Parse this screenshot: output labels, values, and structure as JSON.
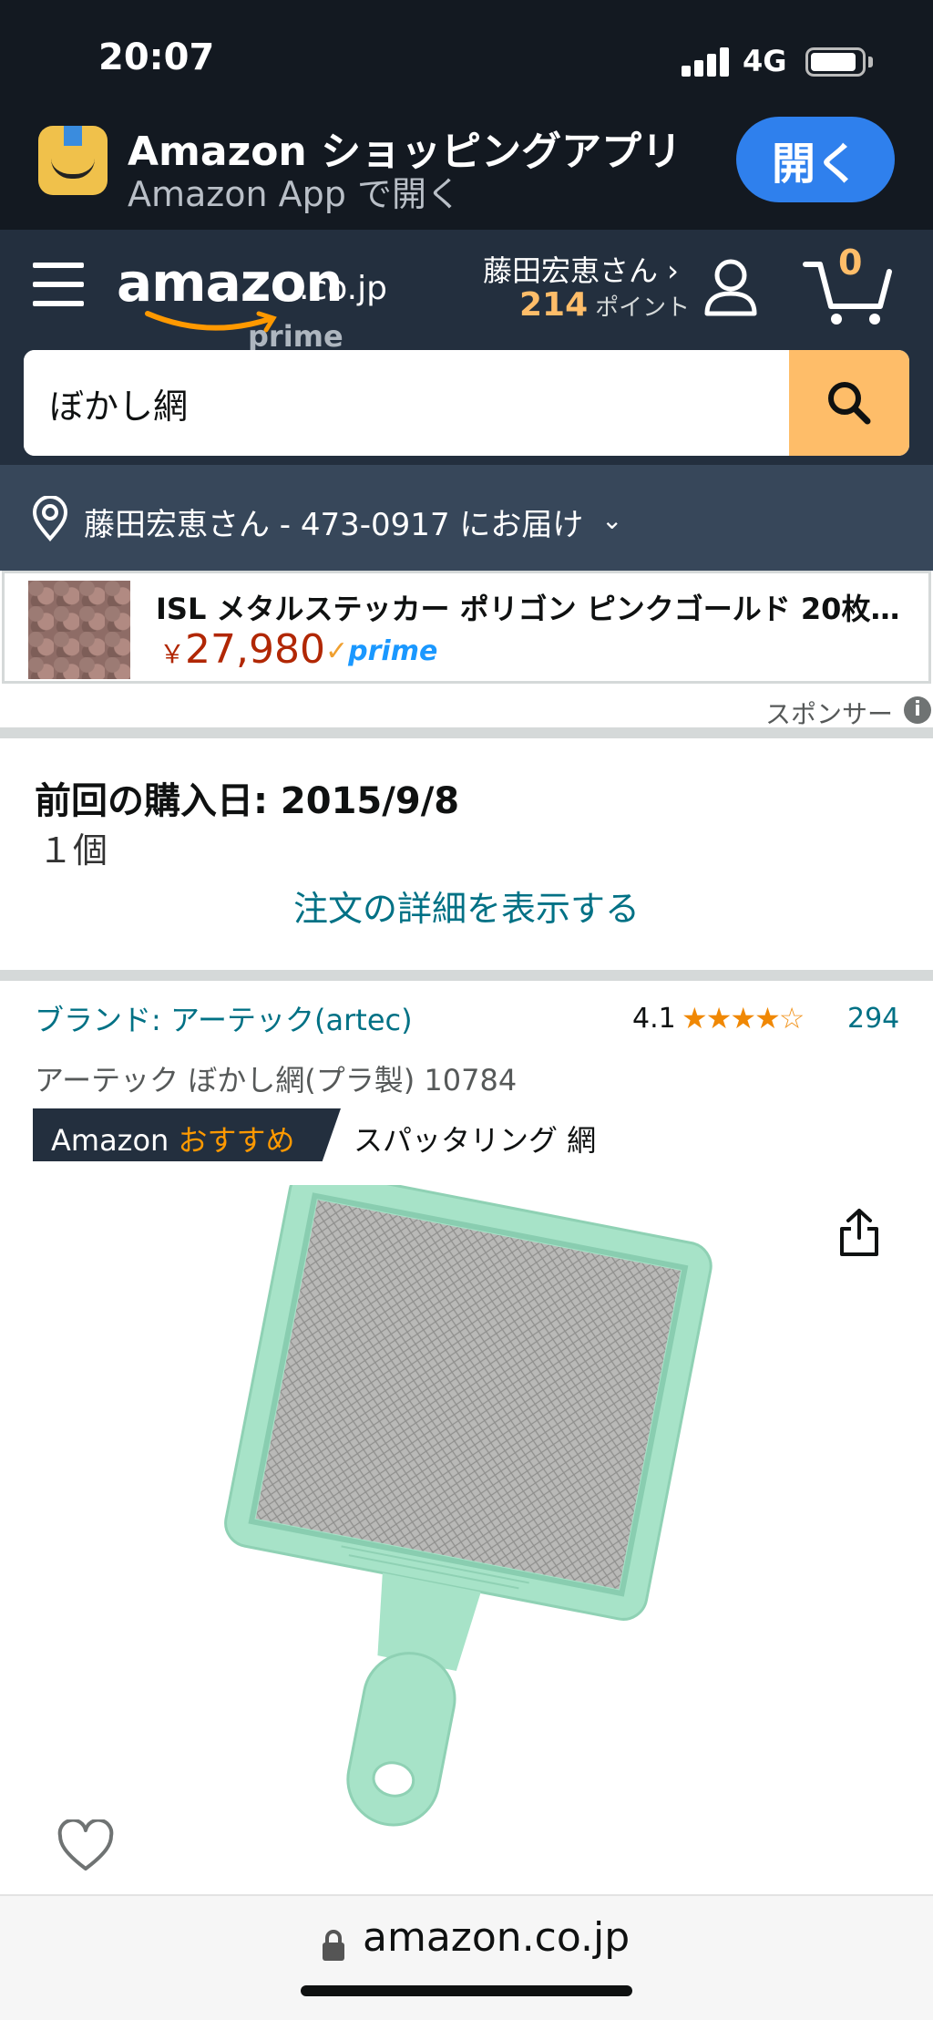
{
  "status_bar": {
    "time": "20:07",
    "network": "4G",
    "battery_level": 0.9,
    "signal_bars": 4
  },
  "app_banner": {
    "title": "Amazon ショッピングアプリ",
    "subtitle": "Amazon App で開く",
    "open_label": "開く",
    "icon": "amazon-app-icon"
  },
  "header": {
    "logo_text": "amazon",
    "logo_domain": ".co.jp",
    "logo_prime": "prime",
    "account_name": "藤田宏恵さん ›",
    "points_value": "214",
    "points_label": "ポイント",
    "cart_count": "0",
    "menu_icon": "hamburger-menu-icon",
    "account_icon": "person-icon",
    "cart_icon": "cart-icon"
  },
  "search": {
    "value": "ぼかし網",
    "icon": "search-icon"
  },
  "delivery": {
    "text": "藤田宏恵さん - 473-0917 にお届け",
    "icon": "location-pin-icon"
  },
  "sponsored_ad": {
    "title": "ISL メタルステッカー ポリゴン ピンクゴールド 20枚…",
    "currency": "￥",
    "price": "27,980",
    "prime_label": "prime",
    "sponsor_label": "スポンサー"
  },
  "last_purchase": {
    "label": "前回の購入日: 2015/9/8",
    "quantity": "１個",
    "order_link": "注文の詳細を表示する"
  },
  "product": {
    "brand": "ブランド: アーテック(artec)",
    "rating_value": "4.1",
    "rating": 4.1,
    "stars": 5,
    "review_count": "294",
    "title": "アーテック ぼかし網(プラ製) 10784",
    "choice_prefix": "Amazon",
    "choice_accent": "おすすめ",
    "choice_keyword": "スパッタリング 網"
  },
  "url_bar": {
    "url": "amazon.co.jp"
  },
  "colors": {
    "header_dark": "#131921",
    "nav": "#232f3e",
    "delivery_bar": "#37475a",
    "accent_orange": "#febd69",
    "link_teal": "#007185",
    "price_red": "#b12704",
    "open_button_blue": "#2f80ed",
    "product_green": "#9fe0c3"
  }
}
